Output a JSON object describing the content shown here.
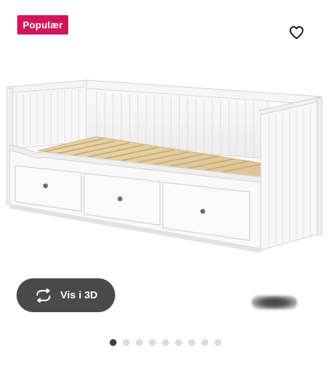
{
  "badge": {
    "label": "Populær",
    "color": "#d2155a"
  },
  "favorite": {
    "icon": "heart-outline-icon",
    "selected": false
  },
  "product_image": {
    "description_icon": "daybed-with-three-drawers-image"
  },
  "view_3d": {
    "label": "Vis i 3D",
    "icon": "rotate-arrows-icon",
    "background": "#4a4a4a"
  },
  "carousel": {
    "total": 9,
    "active_index": 0
  }
}
